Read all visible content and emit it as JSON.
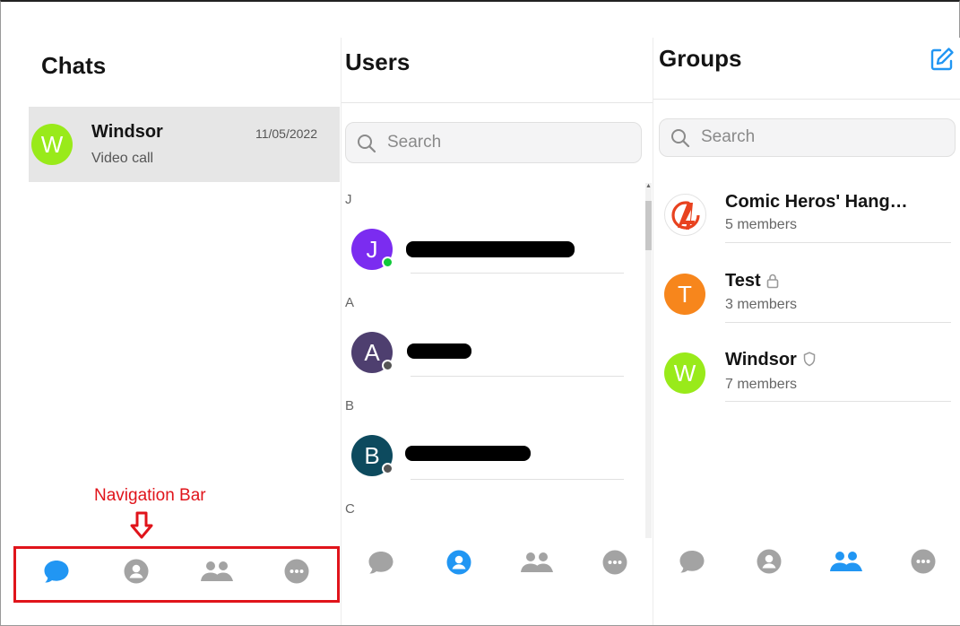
{
  "chats": {
    "title": "Chats",
    "items": [
      {
        "initial": "W",
        "name": "Windsor",
        "preview": "Video call",
        "date": "11/05/2022",
        "avatar_color": "#99ea1a"
      }
    ]
  },
  "users": {
    "title": "Users",
    "search_placeholder": "Search",
    "sections": [
      {
        "letter": "J",
        "user": {
          "initial": "J",
          "avatar_color": "#7b2cf0",
          "presence": "online",
          "presence_color": "#11c93a"
        }
      },
      {
        "letter": "A",
        "user": {
          "initial": "A",
          "avatar_color": "#4e3f6f",
          "presence": "offline",
          "presence_color": "#555555"
        }
      },
      {
        "letter": "B",
        "user": {
          "initial": "B",
          "avatar_color": "#0d4a5e",
          "presence": "offline",
          "presence_color": "#555555"
        }
      },
      {
        "letter": "C"
      }
    ]
  },
  "groups": {
    "title": "Groups",
    "search_placeholder": "Search",
    "compose_icon": "edit-icon",
    "items": [
      {
        "name": "Comic Heros' Hang…",
        "members": "5 members",
        "avatar": "avengers-logo",
        "badge": ""
      },
      {
        "initial": "T",
        "name": "Test",
        "members": "3 members",
        "avatar_color": "#f7861c",
        "badge": "lock-icon"
      },
      {
        "initial": "W",
        "name": "Windsor",
        "members": "7 members",
        "avatar_color": "#99ea1a",
        "badge": "shield-icon"
      }
    ]
  },
  "navbar": {
    "items": [
      "chats-icon",
      "user-icon",
      "groups-icon",
      "more-icon"
    ],
    "active_color": "#2196f3",
    "inactive_color": "#a3a3a3"
  },
  "annotation": {
    "label": "Navigation Bar",
    "color": "#e0141b"
  }
}
